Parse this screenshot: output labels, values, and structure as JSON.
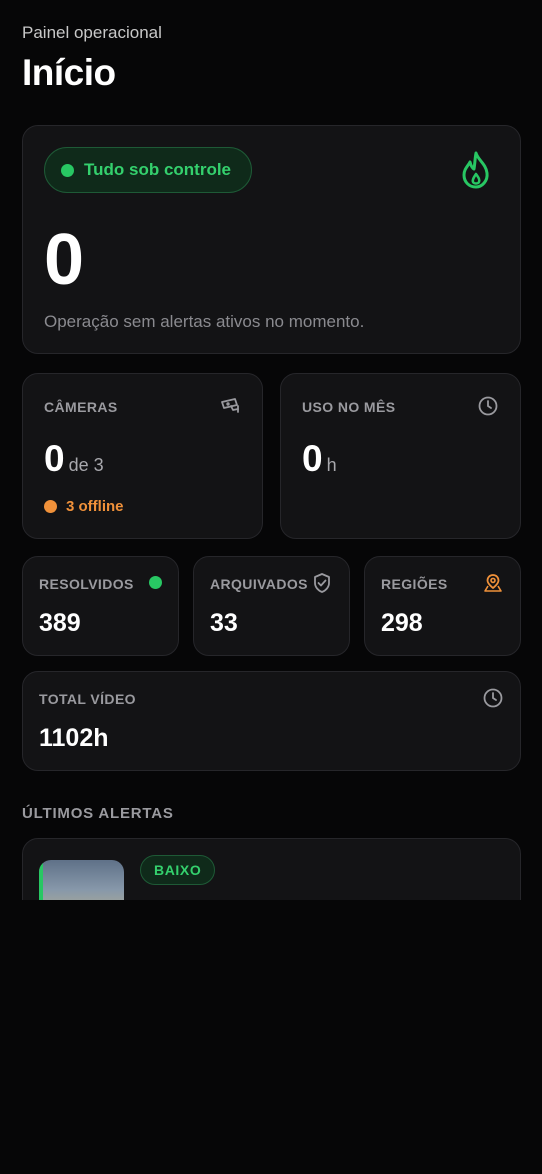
{
  "header": {
    "subtitle": "Painel operacional",
    "title": "Início"
  },
  "status": {
    "label": "Tudo sob controle",
    "count": "0",
    "description": "Operação sem alertas ativos no momento.",
    "icon": "flame-icon",
    "color": "#28c763"
  },
  "cameras": {
    "label": "CÂMERAS",
    "value": "0",
    "suffix": "de 3",
    "offline": "3 offline",
    "icon": "cctv-camera-icon",
    "offline_color": "#f0913a"
  },
  "usage": {
    "label": "USO NO MÊS",
    "value": "0",
    "suffix": "h",
    "icon": "clock-icon"
  },
  "stats": [
    {
      "label": "RESOLVIDOS",
      "value": "389",
      "icon": "green-dot-icon"
    },
    {
      "label": "ARQUIVADOS",
      "value": "33",
      "icon": "shield-check-icon"
    },
    {
      "label": "REGIÕES",
      "value": "298",
      "icon": "map-pin-icon"
    }
  ],
  "total_video": {
    "label": "TOTAL VÍDEO",
    "value": "1102h",
    "icon": "clock-icon"
  },
  "alerts_section": {
    "title": "ÚLTIMOS ALERTAS",
    "items": [
      {
        "level": "BAIXO",
        "title": ""
      }
    ]
  }
}
